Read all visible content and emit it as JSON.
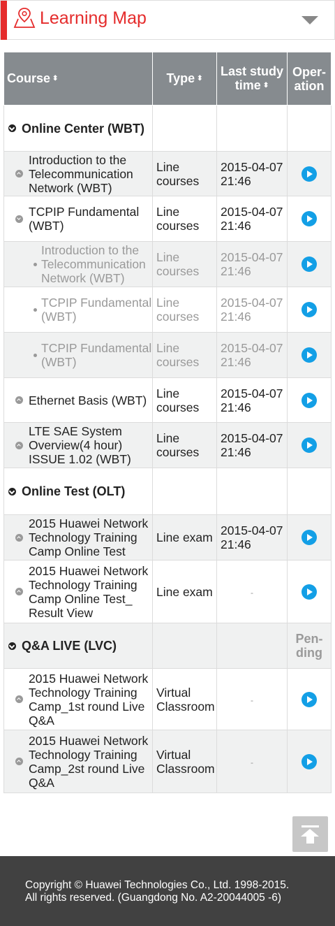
{
  "header": {
    "title": "Learning Map",
    "icon": "map-location-icon",
    "accent_color": "#e52c2c"
  },
  "table": {
    "columns": [
      {
        "label": "Course",
        "sortable": true
      },
      {
        "label": "Type",
        "sortable": true
      },
      {
        "label": "Last study time",
        "sortable": true
      },
      {
        "label": "Oper-ation",
        "sortable": false
      }
    ],
    "rows": [
      {
        "level": 1,
        "course": "Online Center (WBT)",
        "type": "",
        "time": "",
        "op": ""
      },
      {
        "level": 2,
        "course": "Introduction to the Telecommunication Network (WBT)",
        "type": "Line courses",
        "time": "2015-04-07 21:46",
        "op": "play"
      },
      {
        "level": 2,
        "course": "TCPIP Fundamental (WBT)",
        "type": "Line courses",
        "time": "2015-04-07 21:46",
        "op": "play"
      },
      {
        "level": 3,
        "course": "Introduction to the Telecommunication Network (WBT)",
        "type": "Line courses",
        "time": "2015-04-07 21:46",
        "op": "play"
      },
      {
        "level": 3,
        "course": "TCPIP Fundamental (WBT)",
        "type": "Line courses",
        "time": "2015-04-07 21:46",
        "op": "play"
      },
      {
        "level": 3,
        "course": "TCPIP Fundamental (WBT)",
        "type": "Line courses",
        "time": "2015-04-07 21:46",
        "op": "play"
      },
      {
        "level": 2,
        "course": "Ethernet Basis (WBT)",
        "type": "Line courses",
        "time": "2015-04-07 21:46",
        "op": "play"
      },
      {
        "level": 2,
        "course": "LTE SAE System Overview(4 hour) ISSUE 1.02 (WBT)",
        "type": "Line courses",
        "time": "2015-04-07 21:46",
        "op": "play"
      },
      {
        "level": 1,
        "course": "Online Test (OLT)",
        "type": "",
        "time": "",
        "op": ""
      },
      {
        "level": 2,
        "course": "2015 Huawei Network Technology Training Camp Online Test",
        "type": "Line exam",
        "time": "2015-04-07 21:46",
        "op": "play"
      },
      {
        "level": 2,
        "course": "2015 Huawei Network Technology Training Camp Online Test_ Result View",
        "type": "Line exam",
        "time": "-",
        "op": "play"
      },
      {
        "level": 1,
        "course": "Q&A LIVE (LVC)",
        "type": "",
        "time": "",
        "op": "Pen-ding"
      },
      {
        "level": 2,
        "course": "2015 Huawei Network Technology Training Camp_1st round Live Q&A",
        "type": "Virtual Classroom",
        "time": "-",
        "op": "play"
      },
      {
        "level": 2,
        "course": "2015 Huawei Network Technology Training Camp_2st round Live Q&A",
        "type": "Virtual Classroom",
        "time": "-",
        "op": "play"
      }
    ]
  },
  "back_to_top": {
    "icon": "back-to-top-icon"
  },
  "footer": {
    "line1": "Copyright © Huawei Technologies Co., Ltd. 1998-2015.",
    "line2": "All rights reserved. (Guangdong No. A2-20044005 -6)"
  }
}
